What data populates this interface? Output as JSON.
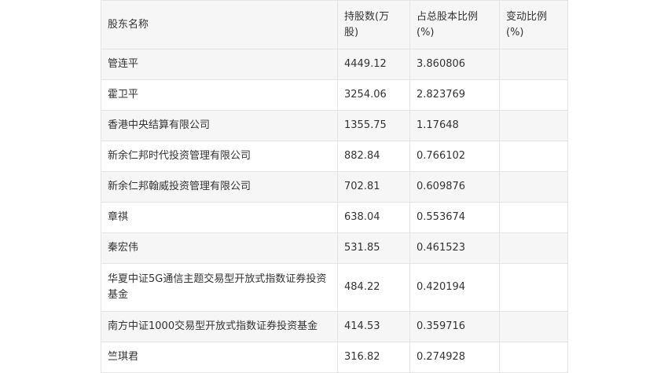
{
  "table": {
    "headers": {
      "name": "股东名称",
      "shares": "持股数(万股)",
      "ratio": "占总股本比例(%)",
      "change": "变动比例(%)"
    },
    "rows": [
      {
        "name": "管连平",
        "shares": "4449.12",
        "ratio": "3.860806",
        "change": ""
      },
      {
        "name": "霍卫平",
        "shares": "3254.06",
        "ratio": "2.823769",
        "change": ""
      },
      {
        "name": "香港中央结算有限公司",
        "shares": "1355.75",
        "ratio": "1.17648",
        "change": ""
      },
      {
        "name": "新余仁邦时代投资管理有限公司",
        "shares": "882.84",
        "ratio": "0.766102",
        "change": ""
      },
      {
        "name": "新余仁邦翰威投资管理有限公司",
        "shares": "702.81",
        "ratio": "0.609876",
        "change": ""
      },
      {
        "name": "章祺",
        "shares": "638.04",
        "ratio": "0.553674",
        "change": ""
      },
      {
        "name": "秦宏伟",
        "shares": "531.85",
        "ratio": "0.461523",
        "change": ""
      },
      {
        "name": "华夏中证5G通信主题交易型开放式指数证券投资基金",
        "shares": "484.22",
        "ratio": "0.420194",
        "change": ""
      },
      {
        "name": "南方中证1000交易型开放式指数证券投资基金",
        "shares": "414.53",
        "ratio": "0.359716",
        "change": ""
      },
      {
        "name": "竺琪君",
        "shares": "316.82",
        "ratio": "0.274928",
        "change": ""
      }
    ]
  }
}
